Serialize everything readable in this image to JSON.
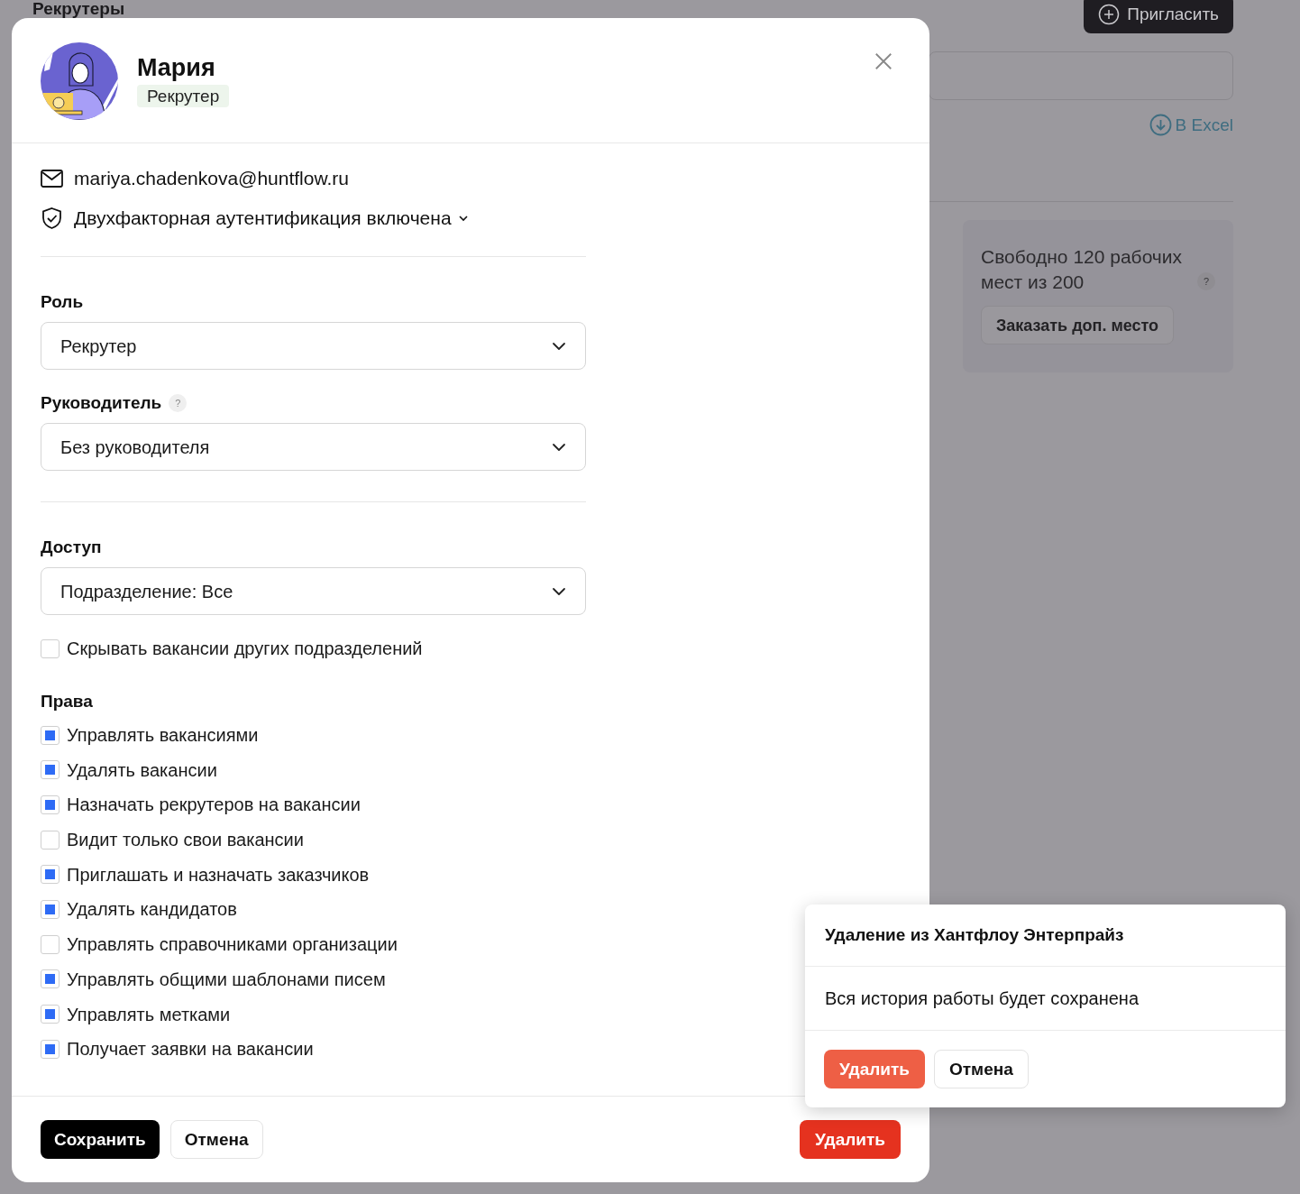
{
  "page": {
    "title": "Рекрутеры",
    "invite_button": "Пригласить",
    "excel_link": "В Excel",
    "seats_text": "Свободно 120 рабочих мест из 200",
    "help_mark": "?",
    "order_button": "Заказать доп. место"
  },
  "modal": {
    "name": "Мария",
    "role_badge": "Рекрутер",
    "email": "mariya.chadenkova@huntflow.ru",
    "two_factor": "Двухфакторная аутентификация включена",
    "role": {
      "label": "Роль",
      "value": "Рекрутер"
    },
    "manager": {
      "label": "Руководитель",
      "help_mark": "?",
      "value": "Без руководителя"
    },
    "access": {
      "label": "Доступ",
      "value": "Подразделение: Все"
    },
    "hide_other": {
      "label": "Скрывать вакансии других подразделений",
      "checked": false
    },
    "rights_label": "Права",
    "rights": [
      {
        "label": "Управлять вакансиями",
        "checked": true
      },
      {
        "label": "Удалять вакансии",
        "checked": true
      },
      {
        "label": "Назначать рекрутеров на вакансии",
        "checked": true
      },
      {
        "label": "Видит только свои вакансии",
        "checked": false
      },
      {
        "label": "Приглашать и назначать заказчиков",
        "checked": true
      },
      {
        "label": "Удалять кандидатов",
        "checked": true
      },
      {
        "label": "Управлять справочниками организации",
        "checked": false
      },
      {
        "label": "Управлять общими шаблонами писем",
        "checked": true
      },
      {
        "label": "Управлять метками",
        "checked": true
      },
      {
        "label": "Получает заявки на вакансии",
        "checked": true
      }
    ],
    "save_button": "Сохранить",
    "cancel_button": "Отмена",
    "delete_button": "Удалить"
  },
  "popover": {
    "title": "Удаление из Хантфлоу Энтерпрайз",
    "message": "Вся история работы будет сохранена",
    "confirm_button": "Удалить",
    "cancel_button": "Отмена"
  }
}
